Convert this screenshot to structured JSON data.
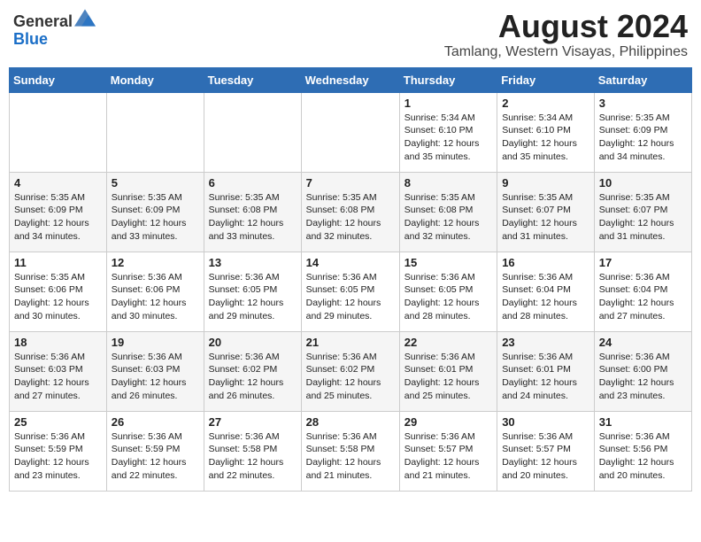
{
  "header": {
    "logo_general": "General",
    "logo_blue": "Blue",
    "title": "August 2024",
    "subtitle": "Tamlang, Western Visayas, Philippines"
  },
  "weekdays": [
    "Sunday",
    "Monday",
    "Tuesday",
    "Wednesday",
    "Thursday",
    "Friday",
    "Saturday"
  ],
  "weeks": [
    [
      {
        "day": "",
        "info": ""
      },
      {
        "day": "",
        "info": ""
      },
      {
        "day": "",
        "info": ""
      },
      {
        "day": "",
        "info": ""
      },
      {
        "day": "1",
        "info": "Sunrise: 5:34 AM\nSunset: 6:10 PM\nDaylight: 12 hours and 35 minutes."
      },
      {
        "day": "2",
        "info": "Sunrise: 5:34 AM\nSunset: 6:10 PM\nDaylight: 12 hours and 35 minutes."
      },
      {
        "day": "3",
        "info": "Sunrise: 5:35 AM\nSunset: 6:09 PM\nDaylight: 12 hours and 34 minutes."
      }
    ],
    [
      {
        "day": "4",
        "info": "Sunrise: 5:35 AM\nSunset: 6:09 PM\nDaylight: 12 hours and 34 minutes."
      },
      {
        "day": "5",
        "info": "Sunrise: 5:35 AM\nSunset: 6:09 PM\nDaylight: 12 hours and 33 minutes."
      },
      {
        "day": "6",
        "info": "Sunrise: 5:35 AM\nSunset: 6:08 PM\nDaylight: 12 hours and 33 minutes."
      },
      {
        "day": "7",
        "info": "Sunrise: 5:35 AM\nSunset: 6:08 PM\nDaylight: 12 hours and 32 minutes."
      },
      {
        "day": "8",
        "info": "Sunrise: 5:35 AM\nSunset: 6:08 PM\nDaylight: 12 hours and 32 minutes."
      },
      {
        "day": "9",
        "info": "Sunrise: 5:35 AM\nSunset: 6:07 PM\nDaylight: 12 hours and 31 minutes."
      },
      {
        "day": "10",
        "info": "Sunrise: 5:35 AM\nSunset: 6:07 PM\nDaylight: 12 hours and 31 minutes."
      }
    ],
    [
      {
        "day": "11",
        "info": "Sunrise: 5:35 AM\nSunset: 6:06 PM\nDaylight: 12 hours and 30 minutes."
      },
      {
        "day": "12",
        "info": "Sunrise: 5:36 AM\nSunset: 6:06 PM\nDaylight: 12 hours and 30 minutes."
      },
      {
        "day": "13",
        "info": "Sunrise: 5:36 AM\nSunset: 6:05 PM\nDaylight: 12 hours and 29 minutes."
      },
      {
        "day": "14",
        "info": "Sunrise: 5:36 AM\nSunset: 6:05 PM\nDaylight: 12 hours and 29 minutes."
      },
      {
        "day": "15",
        "info": "Sunrise: 5:36 AM\nSunset: 6:05 PM\nDaylight: 12 hours and 28 minutes."
      },
      {
        "day": "16",
        "info": "Sunrise: 5:36 AM\nSunset: 6:04 PM\nDaylight: 12 hours and 28 minutes."
      },
      {
        "day": "17",
        "info": "Sunrise: 5:36 AM\nSunset: 6:04 PM\nDaylight: 12 hours and 27 minutes."
      }
    ],
    [
      {
        "day": "18",
        "info": "Sunrise: 5:36 AM\nSunset: 6:03 PM\nDaylight: 12 hours and 27 minutes."
      },
      {
        "day": "19",
        "info": "Sunrise: 5:36 AM\nSunset: 6:03 PM\nDaylight: 12 hours and 26 minutes."
      },
      {
        "day": "20",
        "info": "Sunrise: 5:36 AM\nSunset: 6:02 PM\nDaylight: 12 hours and 26 minutes."
      },
      {
        "day": "21",
        "info": "Sunrise: 5:36 AM\nSunset: 6:02 PM\nDaylight: 12 hours and 25 minutes."
      },
      {
        "day": "22",
        "info": "Sunrise: 5:36 AM\nSunset: 6:01 PM\nDaylight: 12 hours and 25 minutes."
      },
      {
        "day": "23",
        "info": "Sunrise: 5:36 AM\nSunset: 6:01 PM\nDaylight: 12 hours and 24 minutes."
      },
      {
        "day": "24",
        "info": "Sunrise: 5:36 AM\nSunset: 6:00 PM\nDaylight: 12 hours and 23 minutes."
      }
    ],
    [
      {
        "day": "25",
        "info": "Sunrise: 5:36 AM\nSunset: 5:59 PM\nDaylight: 12 hours and 23 minutes."
      },
      {
        "day": "26",
        "info": "Sunrise: 5:36 AM\nSunset: 5:59 PM\nDaylight: 12 hours and 22 minutes."
      },
      {
        "day": "27",
        "info": "Sunrise: 5:36 AM\nSunset: 5:58 PM\nDaylight: 12 hours and 22 minutes."
      },
      {
        "day": "28",
        "info": "Sunrise: 5:36 AM\nSunset: 5:58 PM\nDaylight: 12 hours and 21 minutes."
      },
      {
        "day": "29",
        "info": "Sunrise: 5:36 AM\nSunset: 5:57 PM\nDaylight: 12 hours and 21 minutes."
      },
      {
        "day": "30",
        "info": "Sunrise: 5:36 AM\nSunset: 5:57 PM\nDaylight: 12 hours and 20 minutes."
      },
      {
        "day": "31",
        "info": "Sunrise: 5:36 AM\nSunset: 5:56 PM\nDaylight: 12 hours and 20 minutes."
      }
    ]
  ]
}
